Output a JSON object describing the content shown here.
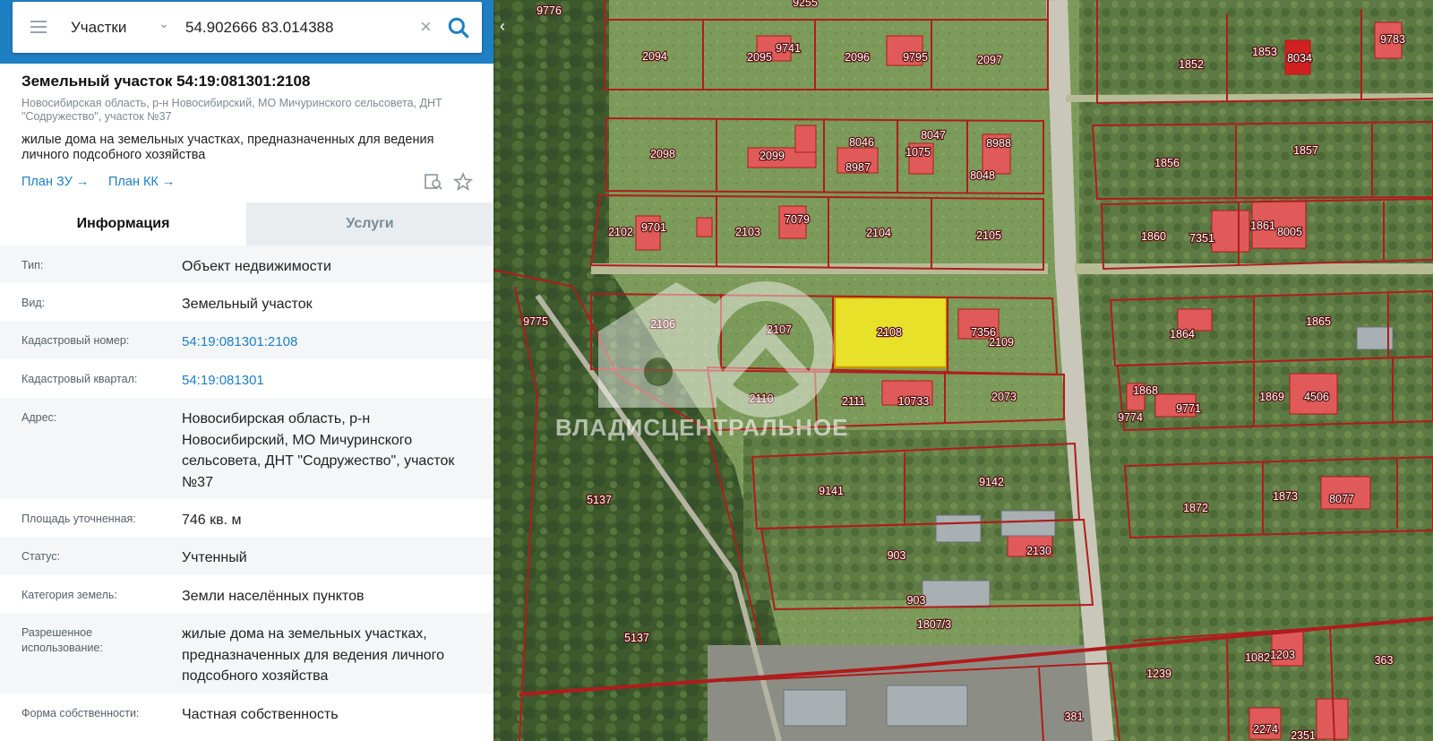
{
  "search": {
    "layer": "Участки",
    "query": "54.902666 83.014388"
  },
  "object": {
    "title": "Земельный участок 54:19:081301:2108",
    "address_short": "Новосибирская область, р-н Новосибирский, МО Мичуринского сельсовета, ДНТ \"Содружество\", участок №37",
    "usage": "жилые дома на земельных участках, предназначенных для ведения личного подсобного хозяйства",
    "links": {
      "plan_zu": "План ЗУ →",
      "plan_kk": "План КК →"
    }
  },
  "tabs": {
    "info": "Информация",
    "services": "Услуги"
  },
  "info_rows": [
    {
      "label": "Тип:",
      "value": "Объект недвижимости"
    },
    {
      "label": "Вид:",
      "value": "Земельный участок"
    },
    {
      "label": "Кадастровый номер:",
      "value": "54:19:081301:2108"
    },
    {
      "label": "Кадастровый квартал:",
      "value": "54:19:081301"
    },
    {
      "label": "Адрес:",
      "value": "Новосибирская область, р-н Новосибирский, МО Мичуринского сельсовета, ДНТ \"Содружество\", участок №37"
    },
    {
      "label": "Площадь уточненная:",
      "value": "746 кв. м"
    },
    {
      "label": "Статус:",
      "value": "Учтенный"
    },
    {
      "label": "Категория земель:",
      "value": "Земли населённых пунктов"
    },
    {
      "label": "Разрешенное использование:",
      "value": "жилые дома на земельных участках, предназначенных для ведения личного подсобного хозяйства"
    },
    {
      "label": "Форма собственности:",
      "value": "Частная собственность"
    }
  ],
  "watermark": "ВЛАДИСЦЕНТРАЛЬНОЕ",
  "map": {
    "selected_parcel": "2108",
    "parcel_numbers": [
      "9776",
      "9255",
      "2094",
      "2095",
      "9741",
      "2096",
      "9795",
      "2097",
      "1853",
      "9783",
      "1852",
      "8034",
      "2098",
      "2099",
      "8046",
      "8047",
      "1075",
      "8988",
      "8987",
      "8048",
      "1856",
      "1857",
      "2102",
      "9701",
      "2103",
      "7079",
      "2104",
      "2105",
      "1860",
      "7351",
      "1861",
      "8005",
      "2106",
      "2107",
      "2108",
      "7356",
      "2109",
      "1864",
      "1865",
      "9775",
      "2110",
      "2111",
      "10733",
      "2073",
      "1868",
      "9771",
      "9774",
      "1869",
      "4506",
      "5137",
      "9141",
      "9142",
      "1872",
      "1873",
      "8077",
      "903",
      "2130",
      "903",
      "1807/3",
      "5137",
      "1239",
      "1082",
      "1203",
      "363",
      "381",
      "2274",
      "2351"
    ],
    "colors": {
      "parcel_border": "#b01c1c",
      "building": "#e05a5a",
      "selected": "#e8e12a"
    }
  }
}
